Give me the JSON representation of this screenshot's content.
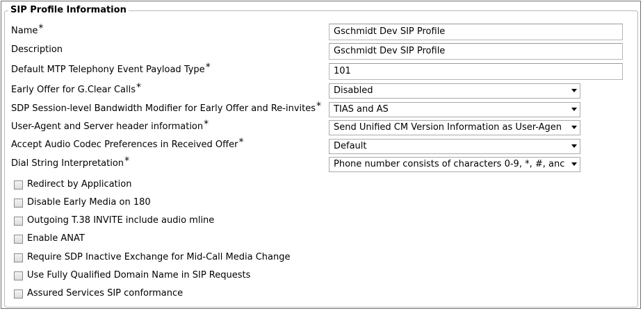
{
  "section": {
    "title": "SIP Profile Information"
  },
  "required_mark": "*",
  "fields": {
    "name": {
      "label": "Name",
      "value": "Gschmidt Dev SIP Profile"
    },
    "description": {
      "label": "Description",
      "value": "Gschmidt Dev SIP Profile"
    },
    "mtp_payload": {
      "label": "Default MTP Telephony Event Payload Type",
      "value": "101"
    },
    "early_offer_gclear": {
      "label": "Early Offer for G.Clear Calls",
      "value": "Disabled"
    },
    "sdp_bandwidth": {
      "label": "SDP Session-level Bandwidth Modifier for Early Offer and Re-invites",
      "value": "TIAS and AS"
    },
    "user_agent": {
      "label": "User-Agent and Server header information",
      "value": "Send Unified CM Version Information as User-Agen"
    },
    "audio_codec_prefs": {
      "label": "Accept Audio Codec Preferences in Received Offer",
      "value": "Default"
    },
    "dial_string": {
      "label": "Dial String Interpretation",
      "value": "Phone number consists of characters 0-9, *, #, anc"
    }
  },
  "checkboxes": [
    {
      "label": "Redirect by Application",
      "checked": false
    },
    {
      "label": "Disable Early Media on 180",
      "checked": false
    },
    {
      "label": "Outgoing T.38 INVITE include audio mline",
      "checked": false
    },
    {
      "label": "Enable ANAT",
      "checked": false
    },
    {
      "label": "Require SDP Inactive Exchange for Mid-Call Media Change",
      "checked": false
    },
    {
      "label": "Use Fully Qualified Domain Name in SIP Requests",
      "checked": false
    },
    {
      "label": "Assured Services SIP conformance",
      "checked": false
    }
  ]
}
